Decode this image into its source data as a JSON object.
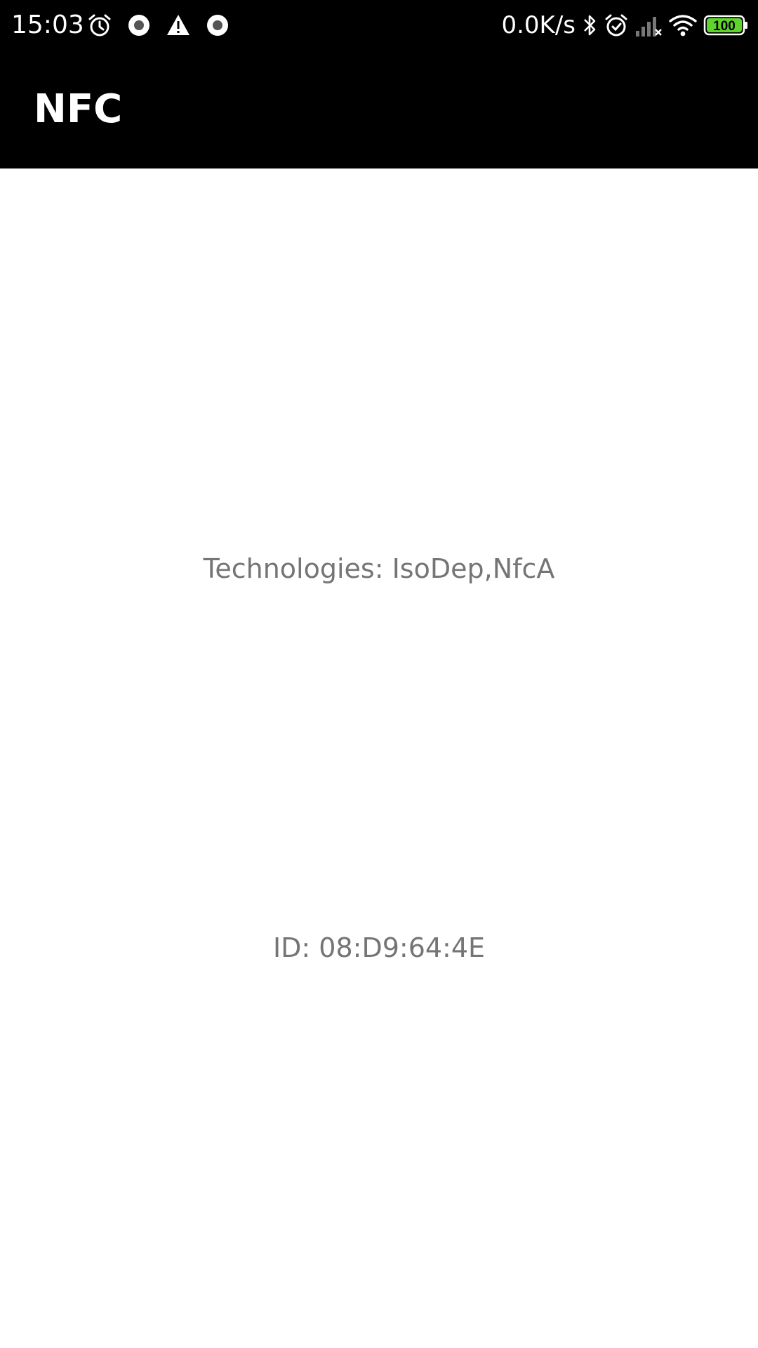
{
  "status_bar": {
    "time": "15:03",
    "net_speed": "0.0K/s",
    "battery_level": "100",
    "left_icons": [
      "alarm-icon",
      "record-icon",
      "warning-icon",
      "record-icon"
    ],
    "right_icons": [
      "bluetooth-icon",
      "alarm-icon",
      "signal-icon",
      "wifi-icon",
      "battery-icon"
    ],
    "battery_color": "#5fd42c"
  },
  "app_bar": {
    "title": "NFC",
    "background": "#000000"
  },
  "content": {
    "technologies": "Technologies: IsoDep,NfcA",
    "id": "ID: 08:D9:64:4E",
    "text_color": "#757575"
  }
}
